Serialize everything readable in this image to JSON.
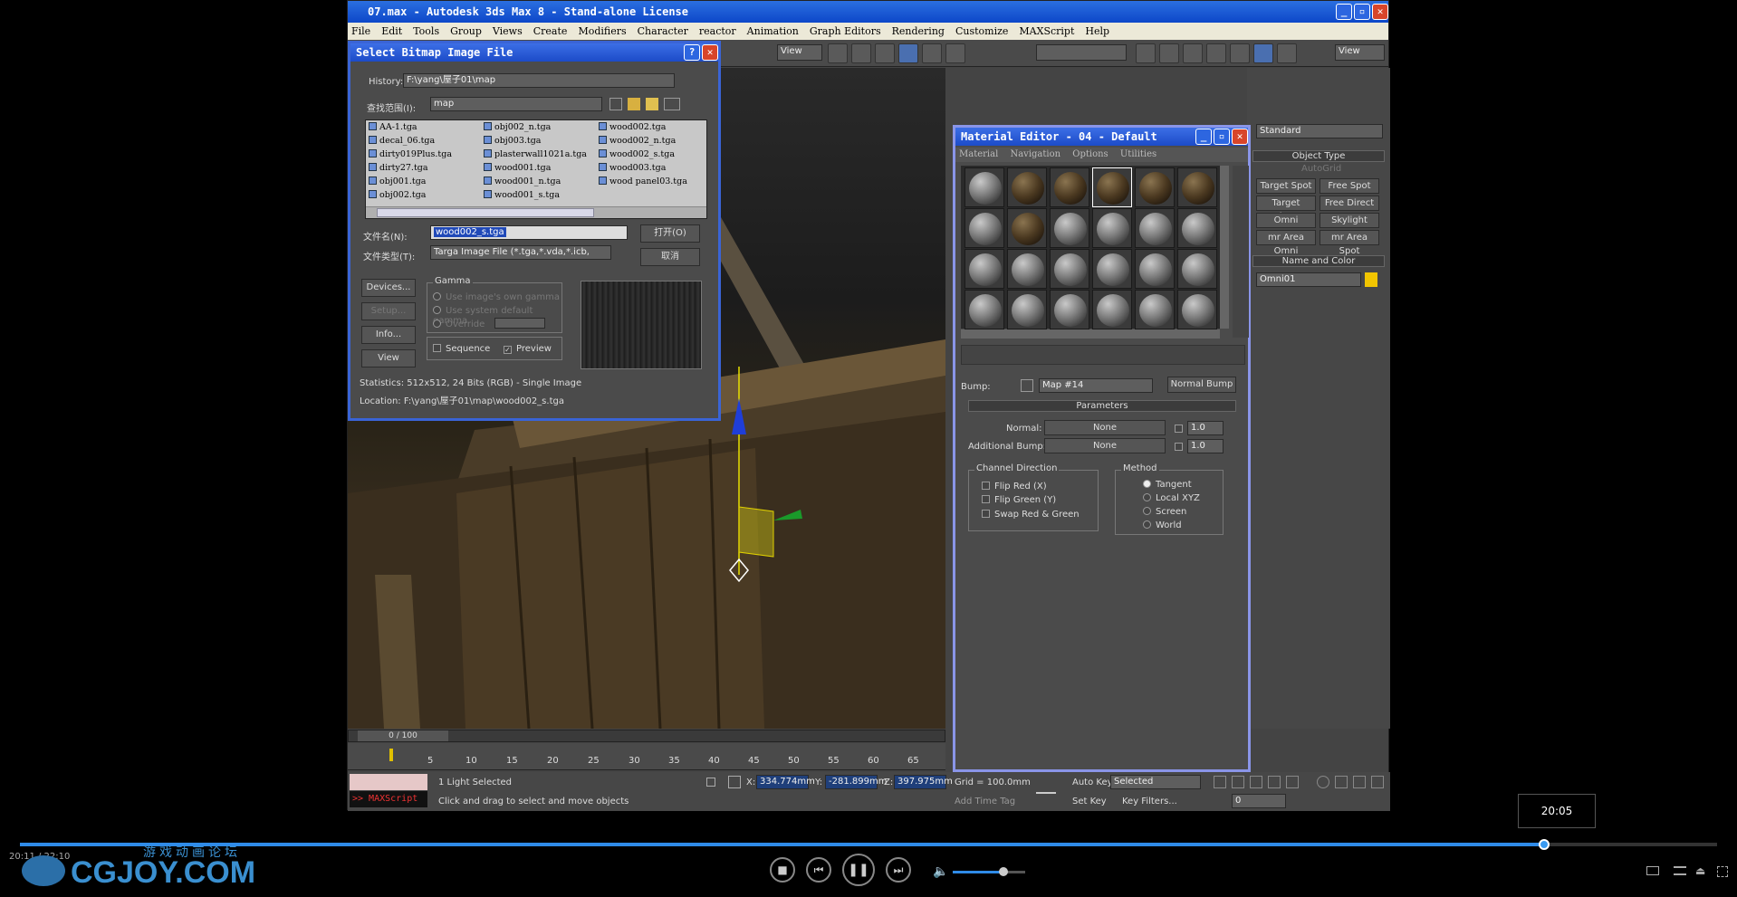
{
  "window": {
    "title": "07.max - Autodesk 3ds Max 8  - Stand-alone License",
    "menu": [
      "File",
      "Edit",
      "Tools",
      "Group",
      "Views",
      "Create",
      "Modifiers",
      "Character",
      "reactor",
      "Animation",
      "Graph Editors",
      "Rendering",
      "Customize",
      "MAXScript",
      "Help"
    ],
    "toolbar_view1": "View",
    "toolbar_view2": "View"
  },
  "bitmap_dialog": {
    "title": "Select Bitmap Image File",
    "history_label": "History:",
    "history_value": "F:\\yang\\屋子01\\map",
    "lookin_label": "查找范围(I):",
    "lookin_value": "map",
    "files": [
      [
        "AA-1.tga",
        "obj002_n.tga",
        "wood002.tga"
      ],
      [
        "decal_06.tga",
        "obj003.tga",
        "wood002_n.tga"
      ],
      [
        "dirty019Plus.tga",
        "plasterwall1021a.tga",
        "wood002_s.tga"
      ],
      [
        "dirty27.tga",
        "wood001.tga",
        "wood003.tga"
      ],
      [
        "obj001.tga",
        "wood001_n.tga",
        "wood panel03.tga"
      ],
      [
        "obj002.tga",
        "wood001_s.tga",
        ""
      ]
    ],
    "filename_label": "文件名(N):",
    "filename_value": "wood002_s.tga",
    "filetype_label": "文件类型(T):",
    "filetype_value": "Targa Image File (*.tga,*.vda,*.icb,",
    "open_btn": "打开(O)",
    "cancel_btn": "取消",
    "devices_btn": "Devices...",
    "setup_btn": "Setup...",
    "info_btn": "Info...",
    "view_btn": "View",
    "gamma_title": "Gamma",
    "gamma_opt1": "Use image's own gamma",
    "gamma_opt2": "Use system default gamma",
    "gamma_opt3": "Override",
    "sequence_label": "Sequence",
    "preview_label": "Preview",
    "statistics": "Statistics:  512x512, 24 Bits (RGB) - Single Image",
    "location": "Location:  F:\\yang\\屋子01\\map\\wood002_s.tga"
  },
  "material_editor": {
    "title": "Material Editor - 04 - Default",
    "menu": [
      "Material",
      "Navigation",
      "Options",
      "Utilities"
    ],
    "bump_label": "Bump:",
    "bump_map": "Map #14",
    "bump_type": "Normal Bump",
    "params_title": "Parameters",
    "normal_label": "Normal:",
    "normal_value": "None",
    "normal_amount": "1.0",
    "addbump_label": "Additional Bump:",
    "addbump_value": "None",
    "addbump_amount": "1.0",
    "channel_title": "Channel Direction",
    "flip_red": "Flip Red (X)",
    "flip_green": "Flip Green (Y)",
    "swap": "Swap Red & Green",
    "method_title": "Method",
    "method_options": [
      "Tangent",
      "Local XYZ",
      "Screen",
      "World"
    ]
  },
  "command_panel": {
    "dropdown": "Standard",
    "object_type": "Object Type",
    "autogrid": "AutoGrid",
    "buttons": [
      "Target Spot",
      "Free Spot",
      "Target Direct",
      "Free Direct",
      "Omni",
      "Skylight",
      "mr Area Omni",
      "mr Area Spot"
    ],
    "name_color": "Name and Color",
    "name_value": "Omni01",
    "color": "#f2c500"
  },
  "timeline": {
    "frame_counter": "0 / 100",
    "ticks": [
      "5",
      "10",
      "15",
      "20",
      "25",
      "30",
      "35",
      "40",
      "45",
      "50",
      "55",
      "60",
      "65"
    ]
  },
  "status": {
    "maxscript": ">> MAXScript",
    "selection": "1 Light Selected",
    "prompt": "Click and drag to select and move objects",
    "x": "334.774mm",
    "y": "-281.899mm",
    "z": "397.975mm",
    "grid": "Grid = 100.0mm",
    "addtime": "Add Time Tag",
    "autokey": "Auto Key",
    "autokey_sel": "Selected",
    "setkey": "Set Key",
    "keyfilters": "Key Filters...",
    "frame": "0"
  },
  "player": {
    "current_time": "20:11 / 22:10",
    "tooltip_time": "20:05",
    "progress": 0.898,
    "volume": 0.7,
    "logo_cn": "游戏动画论坛",
    "logo_main": "CGJOY.COM"
  }
}
